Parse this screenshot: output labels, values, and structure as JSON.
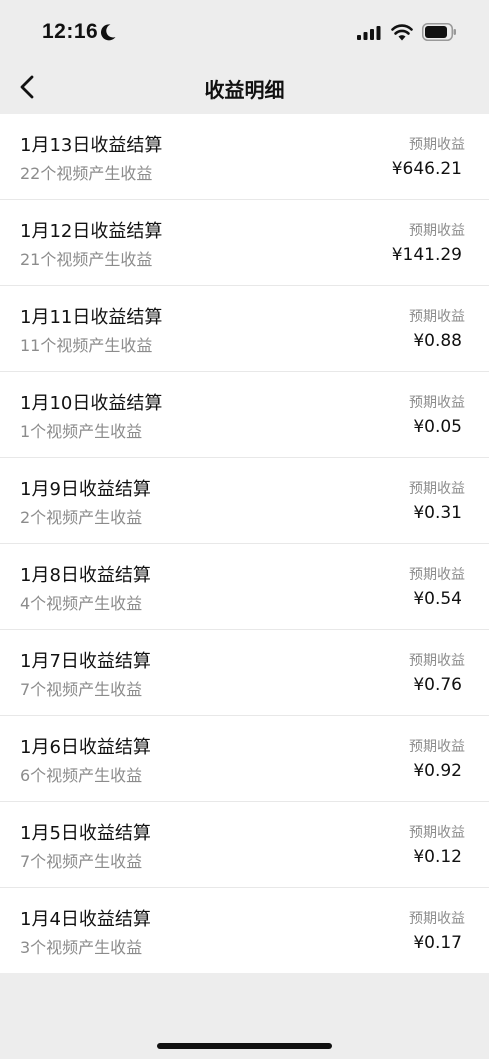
{
  "status_bar": {
    "time": "12:16"
  },
  "nav": {
    "title": "收益明细"
  },
  "rows": [
    {
      "title": "1月13日收益结算",
      "subtitle": "22个视频产生收益",
      "label": "预期收益",
      "amount": "¥646.21"
    },
    {
      "title": "1月12日收益结算",
      "subtitle": "21个视频产生收益",
      "label": "预期收益",
      "amount": "¥141.29"
    },
    {
      "title": "1月11日收益结算",
      "subtitle": "11个视频产生收益",
      "label": "预期收益",
      "amount": "¥0.88"
    },
    {
      "title": "1月10日收益结算",
      "subtitle": "1个视频产生收益",
      "label": "预期收益",
      "amount": "¥0.05"
    },
    {
      "title": "1月9日收益结算",
      "subtitle": "2个视频产生收益",
      "label": "预期收益",
      "amount": "¥0.31"
    },
    {
      "title": "1月8日收益结算",
      "subtitle": "4个视频产生收益",
      "label": "预期收益",
      "amount": "¥0.54"
    },
    {
      "title": "1月7日收益结算",
      "subtitle": "7个视频产生收益",
      "label": "预期收益",
      "amount": "¥0.76"
    },
    {
      "title": "1月6日收益结算",
      "subtitle": "6个视频产生收益",
      "label": "预期收益",
      "amount": "¥0.92"
    },
    {
      "title": "1月5日收益结算",
      "subtitle": "7个视频产生收益",
      "label": "预期收益",
      "amount": "¥0.12"
    },
    {
      "title": "1月4日收益结算",
      "subtitle": "3个视频产生收益",
      "label": "预期收益",
      "amount": "¥0.17"
    }
  ]
}
